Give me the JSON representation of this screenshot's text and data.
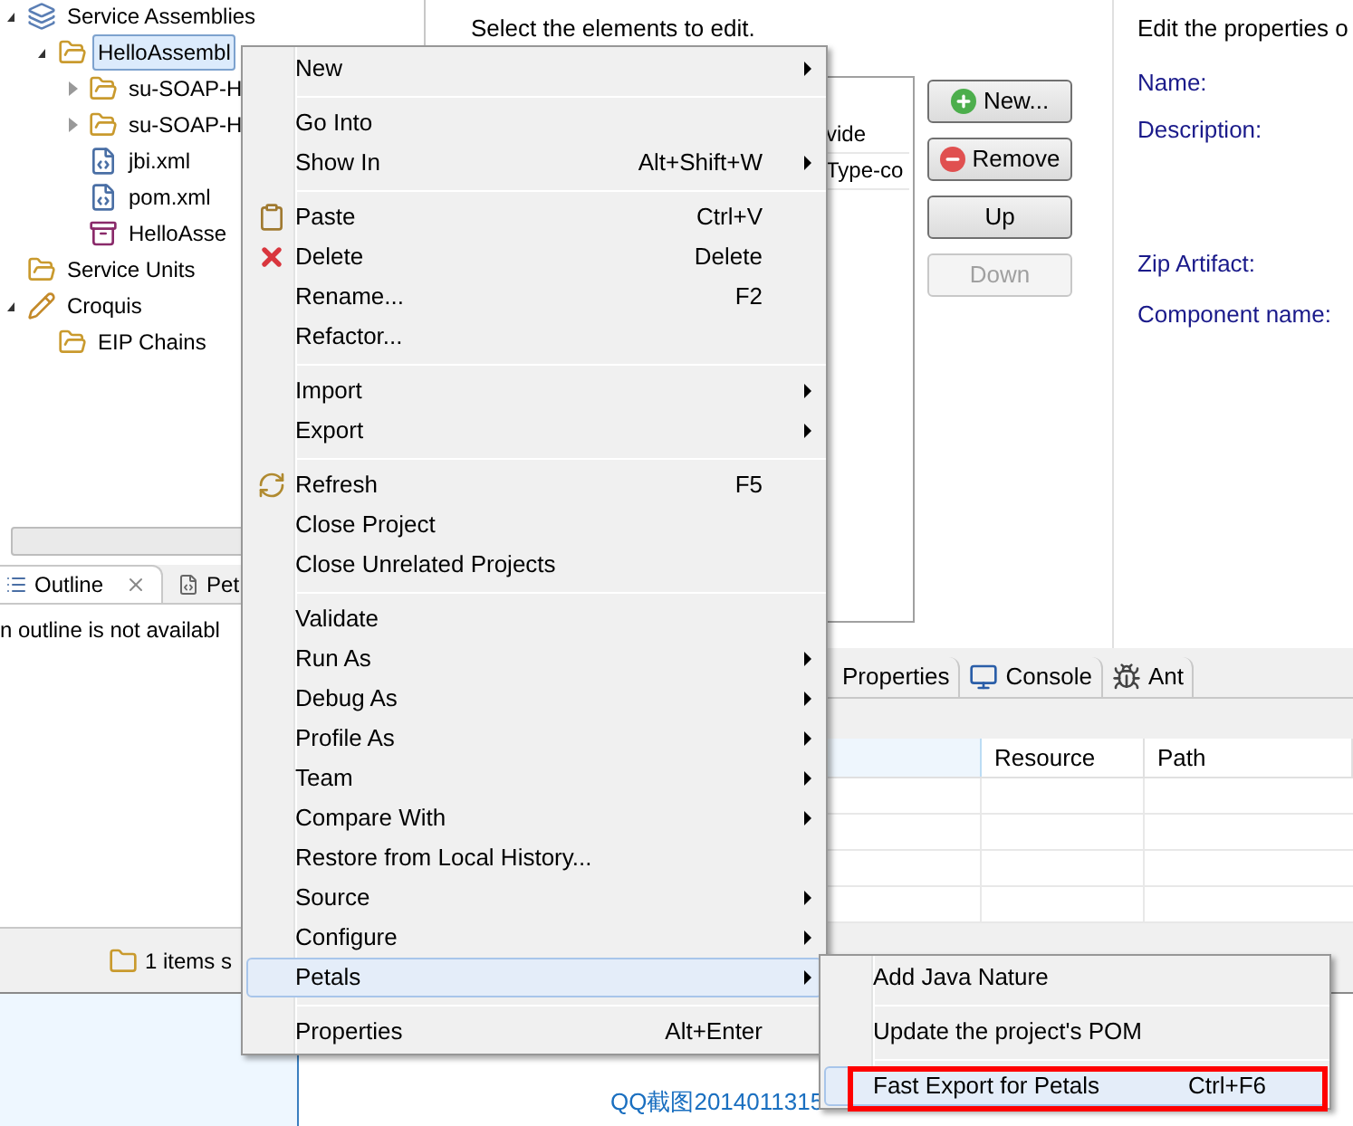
{
  "explorer": {
    "tree": [
      {
        "label": "Service Assemblies",
        "kind": "assembly",
        "expanded": true,
        "selected": false,
        "children": [
          {
            "label": "HelloAssembl",
            "kind": "folder",
            "expanded": true,
            "selected": true,
            "children": [
              {
                "label": "su-SOAP-H",
                "kind": "folder",
                "expanded": false,
                "selected": false
              },
              {
                "label": "su-SOAP-H",
                "kind": "folder",
                "expanded": false,
                "selected": false
              },
              {
                "label": "jbi.xml",
                "kind": "xml",
                "selected": false
              },
              {
                "label": "pom.xml",
                "kind": "xml",
                "selected": false
              },
              {
                "label": "HelloAsse",
                "kind": "archive",
                "selected": false
              }
            ]
          }
        ]
      },
      {
        "label": "Service Units",
        "kind": "folder",
        "selected": false
      },
      {
        "label": "Croquis",
        "kind": "pencil",
        "expanded": true,
        "selected": false,
        "children": [
          {
            "label": "EIP Chains",
            "kind": "folder",
            "selected": false
          }
        ]
      }
    ]
  },
  "outline": {
    "tabs": [
      {
        "label": "Outline",
        "selected": true
      },
      {
        "label": "Pet",
        "selected": false
      }
    ],
    "message": "n outline is not availabl",
    "status": "1 items s"
  },
  "editor": {
    "instruction": "Select the elements to edit.",
    "list_items": [
      "vide",
      "Type-co"
    ],
    "buttons": [
      {
        "label": "New...",
        "kind": "add",
        "disabled": false
      },
      {
        "label": "Remove",
        "kind": "remove",
        "disabled": false
      },
      {
        "label": "Up",
        "kind": "plain",
        "disabled": false
      },
      {
        "label": "Down",
        "kind": "plain",
        "disabled": true
      }
    ],
    "properties_hint": "Edit the properties o",
    "fields": [
      "Name:",
      "Description:",
      "Zip Artifact:",
      "Component name:"
    ]
  },
  "bottom_panel": {
    "tabs": [
      {
        "label": "Properties",
        "selected": false
      },
      {
        "label": "Console",
        "selected": false
      },
      {
        "label": "Ant",
        "selected": false
      }
    ],
    "columns": [
      "Resource",
      "Path"
    ]
  },
  "background_window": {
    "file_name": "QQ截图2014011315"
  },
  "context_menu": {
    "groups": [
      [
        {
          "label": "New",
          "submenu": true,
          "selected": false
        }
      ],
      [
        {
          "label": "Go Into",
          "selected": false
        },
        {
          "label": "Show In",
          "shortcut": "Alt+Shift+W",
          "submenu": true,
          "selected": false
        }
      ],
      [
        {
          "label": "Paste",
          "shortcut": "Ctrl+V",
          "kind": "paste",
          "selected": false
        },
        {
          "label": "Delete",
          "shortcut": "Delete",
          "kind": "delete",
          "selected": false
        },
        {
          "label": "Rename...",
          "shortcut": "F2",
          "selected": false
        },
        {
          "label": "Refactor...",
          "selected": false
        }
      ],
      [
        {
          "label": "Import",
          "submenu": true,
          "selected": false
        },
        {
          "label": "Export",
          "submenu": true,
          "selected": false
        }
      ],
      [
        {
          "label": "Refresh",
          "shortcut": "F5",
          "kind": "refresh",
          "selected": false
        },
        {
          "label": "Close Project",
          "selected": false
        },
        {
          "label": "Close Unrelated Projects",
          "selected": false
        }
      ],
      [
        {
          "label": "Validate",
          "selected": false
        },
        {
          "label": "Run As",
          "submenu": true,
          "selected": false
        },
        {
          "label": "Debug As",
          "submenu": true,
          "selected": false
        },
        {
          "label": "Profile As",
          "submenu": true,
          "selected": false
        },
        {
          "label": "Team",
          "submenu": true,
          "selected": false
        },
        {
          "label": "Compare With",
          "submenu": true,
          "selected": false
        },
        {
          "label": "Restore from Local History...",
          "selected": false
        },
        {
          "label": "Source",
          "submenu": true,
          "selected": false
        },
        {
          "label": "Configure",
          "submenu": true,
          "selected": false
        },
        {
          "label": "Petals",
          "submenu": true,
          "selected": true
        }
      ],
      [
        {
          "label": "Properties",
          "shortcut": "Alt+Enter",
          "selected": false
        }
      ]
    ]
  },
  "submenu": {
    "groups": [
      [
        {
          "label": "Add Java Nature",
          "selected": false
        }
      ],
      [
        {
          "label": "Update the project's POM",
          "selected": false
        }
      ],
      [
        {
          "label": "Fast Export for Petals",
          "shortcut": "Ctrl+F6",
          "selected": true,
          "annotated": true
        }
      ]
    ]
  }
}
